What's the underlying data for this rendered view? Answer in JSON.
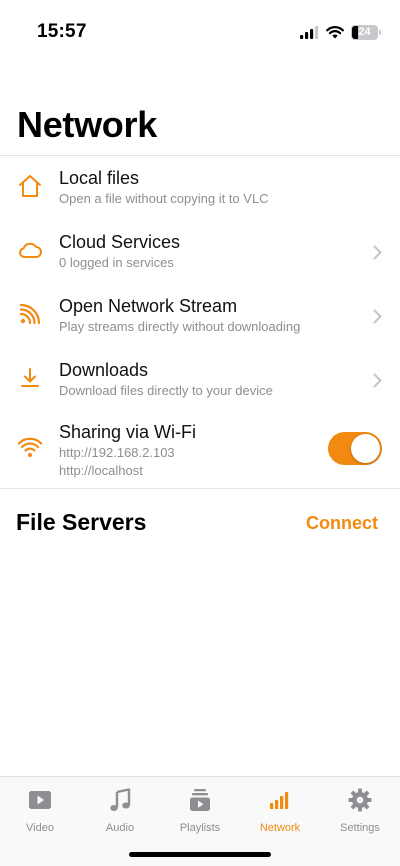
{
  "status_bar": {
    "time": "15:57",
    "battery": "24"
  },
  "page_title": "Network",
  "items": [
    {
      "title": "Local files",
      "subtitle": "Open a file without copying it to VLC",
      "icon": "home-icon"
    },
    {
      "title": "Cloud Services",
      "subtitle": "0 logged in services",
      "icon": "cloud-icon"
    },
    {
      "title": "Open Network Stream",
      "subtitle": "Play streams directly without downloading",
      "icon": "rss-icon"
    },
    {
      "title": "Downloads",
      "subtitle": "Download files directly to your device",
      "icon": "download-icon"
    },
    {
      "title": "Sharing via Wi-Fi",
      "subtitle": "http://192.168.2.103",
      "subtitle2": "http://localhost",
      "icon": "wifi-icon",
      "toggle_on": true
    }
  ],
  "file_servers": {
    "title": "File Servers",
    "connect_label": "Connect"
  },
  "tabs": [
    {
      "label": "Video",
      "icon": "video-icon"
    },
    {
      "label": "Audio",
      "icon": "music-note-icon"
    },
    {
      "label": "Playlists",
      "icon": "playlists-icon"
    },
    {
      "label": "Network",
      "icon": "network-bars-icon",
      "active": true
    },
    {
      "label": "Settings",
      "icon": "gear-icon"
    }
  ],
  "colors": {
    "accent": "#f28a11",
    "subtitle": "#8e8e93",
    "tab_inactive": "#8e8e93"
  }
}
